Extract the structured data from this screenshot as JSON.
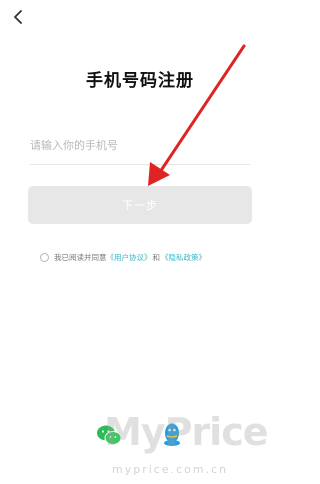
{
  "header": {
    "back_icon": "chevron-left-icon"
  },
  "title": "手机号码注册",
  "phone_input": {
    "placeholder": "请输入你的手机号",
    "value": ""
  },
  "next_button": {
    "label": "下一步"
  },
  "agreement": {
    "prefix": "我已阅读并同意",
    "user_agreement": "《用户协议》",
    "conjunction": "和",
    "privacy_policy": "《隐私政策》"
  },
  "social": {
    "wechat_icon": "wechat-icon",
    "qq_icon": "qq-icon"
  },
  "annotation": {
    "arrow_color": "#e02424"
  },
  "watermark": {
    "text": "MyPrice",
    "url": "myprice.com.cn"
  },
  "colors": {
    "button_bg": "#e7e7e7",
    "link": "#35b8c9",
    "wechat": "#2dbb55",
    "qq": "#1fa0e6"
  }
}
